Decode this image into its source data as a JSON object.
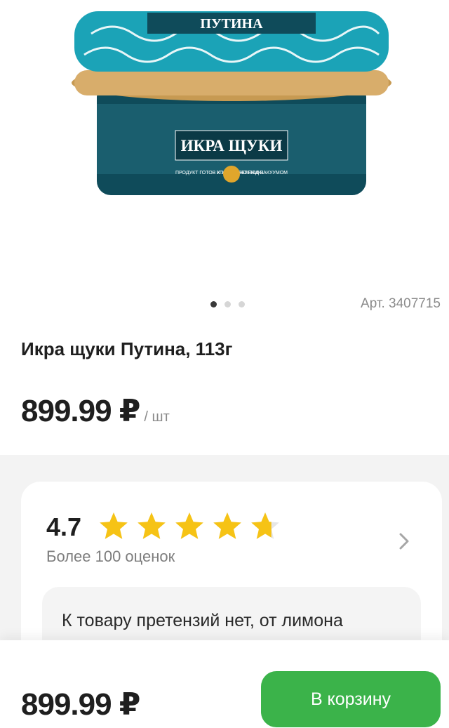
{
  "product": {
    "image_alt_icon": "caviar-jar-image",
    "label_brand": "ПУТИНА",
    "label_title": "ИКРА ЩУКИ",
    "label_left": "ПРОДУКТ ГОТОВ К УПОТРЕБЛЕНИЮ",
    "label_right": "УПАКОВАНО ПОД ВАКУУМОМ",
    "article": "Арт. 3407715",
    "title": "Икра щуки Путина, 113г",
    "price": "899.99 ₽",
    "unit": "/ шт",
    "gallery_dots": 3,
    "gallery_active": 0
  },
  "rating": {
    "value": "4.7",
    "stars_filled": 4.7,
    "stars_max": 5,
    "count_label": "Более 100 оценок",
    "star_color": "#f6c315",
    "chevron_icon": "chevron-right-icon"
  },
  "review": {
    "text": "К товару претензий нет, от лимона"
  },
  "bottom_bar": {
    "price": "899.99 ₽",
    "cart_label": "В корзину",
    "cart_color": "#3bb34a"
  }
}
